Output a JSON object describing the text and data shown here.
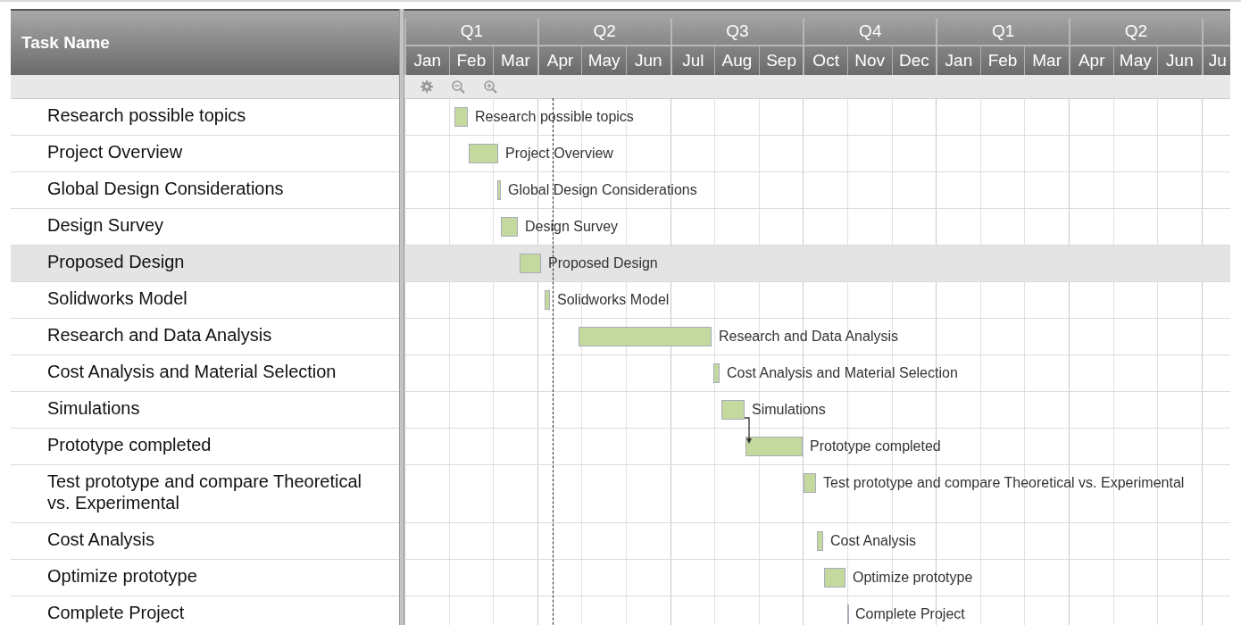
{
  "header": {
    "title": "Task Name",
    "quarters": [
      "Q1",
      "Q2",
      "Q3",
      "Q4",
      "Q1",
      "Q2"
    ],
    "months": [
      "Jan",
      "Feb",
      "Mar",
      "Apr",
      "May",
      "Jun",
      "Jul",
      "Aug",
      "Sep",
      "Oct",
      "Nov",
      "Dec",
      "Jan",
      "Feb",
      "Mar",
      "Apr",
      "May",
      "Jun",
      "Ju"
    ]
  },
  "tasks": [
    {
      "name": "Research possible topics",
      "bar_label": "Research possible topics",
      "selected": false
    },
    {
      "name": "Project Overview",
      "bar_label": "Project Overview",
      "selected": false
    },
    {
      "name": "Global Design Considerations",
      "bar_label": "Global Design Considerations",
      "selected": false
    },
    {
      "name": "Design Survey",
      "bar_label": "Design Survey",
      "selected": false
    },
    {
      "name": "Proposed Design",
      "bar_label": "Proposed Design",
      "selected": true
    },
    {
      "name": "Solidworks Model",
      "bar_label": "Solidworks Model",
      "selected": false
    },
    {
      "name": "Research and Data Analysis",
      "bar_label": "Research and Data Analysis",
      "selected": false
    },
    {
      "name": "Cost Analysis and Material Selection",
      "bar_label": "Cost Analysis and Material Selection",
      "selected": false
    },
    {
      "name": "Simulations",
      "bar_label": "Simulations",
      "selected": false
    },
    {
      "name": "Prototype completed",
      "bar_label": "Prototype completed",
      "selected": false
    },
    {
      "name": "Test prototype and compare Theoretical vs. Experimental",
      "bar_label": "Test prototype and compare Theoretical vs. Experimental",
      "selected": false
    },
    {
      "name": "Cost Analysis",
      "bar_label": "Cost Analysis",
      "selected": false
    },
    {
      "name": "Optimize prototype",
      "bar_label": "Optimize prototype",
      "selected": false
    },
    {
      "name": "Complete Project",
      "bar_label": "Complete Project",
      "selected": false
    }
  ]
}
